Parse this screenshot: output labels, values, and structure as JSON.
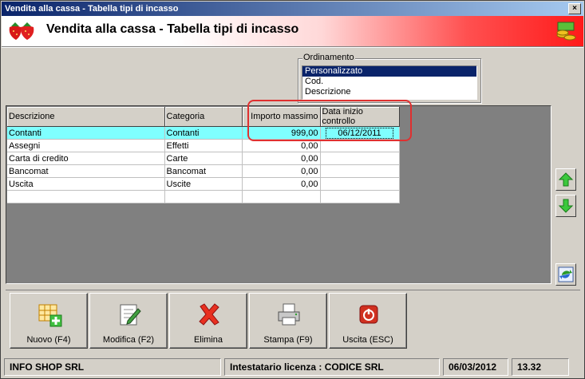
{
  "window": {
    "title": "Vendita alla cassa - Tabella tipi di incasso",
    "close_glyph": "×"
  },
  "header": {
    "title": "Vendita alla cassa - Tabella tipi di incasso"
  },
  "ordering": {
    "legend": "Ordinamento",
    "options": [
      "Personalizzato",
      "Cod.",
      "Descrizione"
    ],
    "selected": "Personalizzato"
  },
  "grid": {
    "columns": [
      "Descrizione",
      "Categoria",
      "Importo massimo",
      "Data inizio controllo"
    ],
    "rows": [
      {
        "descrizione": "Contanti",
        "categoria": "Contanti",
        "importo": "999,00",
        "data": "06/12/2011"
      },
      {
        "descrizione": "Assegni",
        "categoria": "Effetti",
        "importo": "0,00",
        "data": ""
      },
      {
        "descrizione": "Carta di credito",
        "categoria": "Carte",
        "importo": "0,00",
        "data": ""
      },
      {
        "descrizione": "Bancomat",
        "categoria": "Bancomat",
        "importo": "0,00",
        "data": ""
      },
      {
        "descrizione": "Uscita",
        "categoria": "Uscite",
        "importo": "0,00",
        "data": ""
      },
      {
        "descrizione": "",
        "categoria": "",
        "importo": "",
        "data": ""
      }
    ],
    "selected_row_color": "#7fffff"
  },
  "side_buttons": {
    "up": "arrow-up-icon",
    "down": "arrow-down-icon",
    "refresh": "refresh-icon"
  },
  "toolbar": {
    "nuovo": "Nuovo (F4)",
    "modifica": "Modifica (F2)",
    "elimina": "Elimina",
    "stampa": "Stampa (F9)",
    "uscita": "Uscita (ESC)"
  },
  "statusbar": {
    "company": "INFO SHOP SRL",
    "license": "Intestatario licenza : CODICE SRL",
    "date": "06/03/2012",
    "time": "13.32"
  },
  "colors": {
    "highlight": "#e03030",
    "title_start": "#0a246a",
    "header_end": "#ff1a1a"
  }
}
